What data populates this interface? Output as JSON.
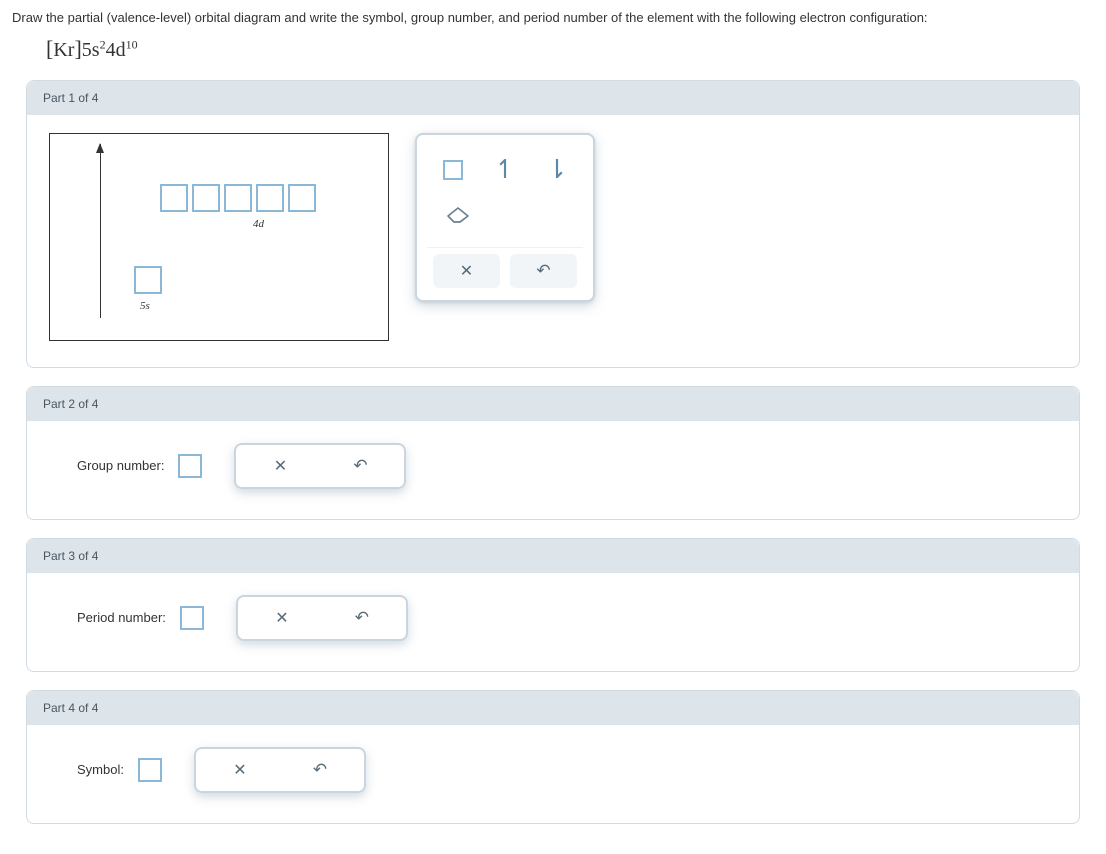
{
  "question": "Draw the partial (valence-level) orbital diagram and write the symbol, group number, and period number of the element with the following electron configuration:",
  "config": {
    "core": "Kr",
    "term1_orbital": "5s",
    "term1_exp": "2",
    "term2_orbital": "4d",
    "term2_exp": "10"
  },
  "parts": {
    "p1": {
      "header": "Part 1 of 4"
    },
    "p2": {
      "header": "Part 2 of 4",
      "label": "Group number:",
      "value": ""
    },
    "p3": {
      "header": "Part 3 of 4",
      "label": "Period number:",
      "value": ""
    },
    "p4": {
      "header": "Part 4 of 4",
      "label": "Symbol:",
      "value": ""
    }
  },
  "orbital_labels": {
    "d": "4d",
    "s": "5s"
  },
  "tools": {
    "box": "orbital-box",
    "up": "↿",
    "down": "⇂",
    "eraser": "eraser",
    "clear": "✕",
    "undo": "↶"
  }
}
